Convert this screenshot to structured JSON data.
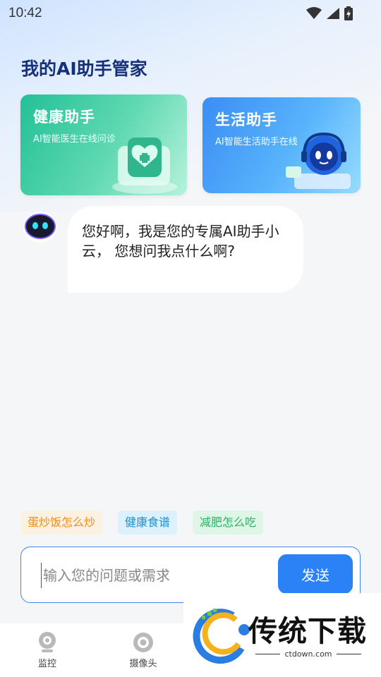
{
  "status_bar": {
    "time": "10:42"
  },
  "header": {
    "title": "我的AI助手管家"
  },
  "cards": [
    {
      "title": "健康助手",
      "subtitle": "AI智能医生在线问诊"
    },
    {
      "title": "生活助手",
      "subtitle": "AI智能生活助手在线"
    }
  ],
  "chat": {
    "messages": [
      {
        "sender": "assistant",
        "text": "您好啊，我是您的专属AI助手小云， 您想问我点什么啊?"
      }
    ]
  },
  "suggestions": [
    "蛋炒饭怎么炒",
    "健康食谱",
    "减肥怎么吃"
  ],
  "input": {
    "placeholder": "输入您的问题或需求",
    "value": "",
    "send_label": "发送"
  },
  "tabs": [
    {
      "label": "监控",
      "icon": "webcam-icon"
    },
    {
      "label": "摄像头",
      "icon": "camera-lens-icon"
    }
  ],
  "watermark": {
    "brand": "传统下载",
    "site": "ctdown.com"
  },
  "colors": {
    "title": "#17307a",
    "primary": "#2b82f6",
    "health_card": "#23c097",
    "life_card": "#3b8df4"
  }
}
